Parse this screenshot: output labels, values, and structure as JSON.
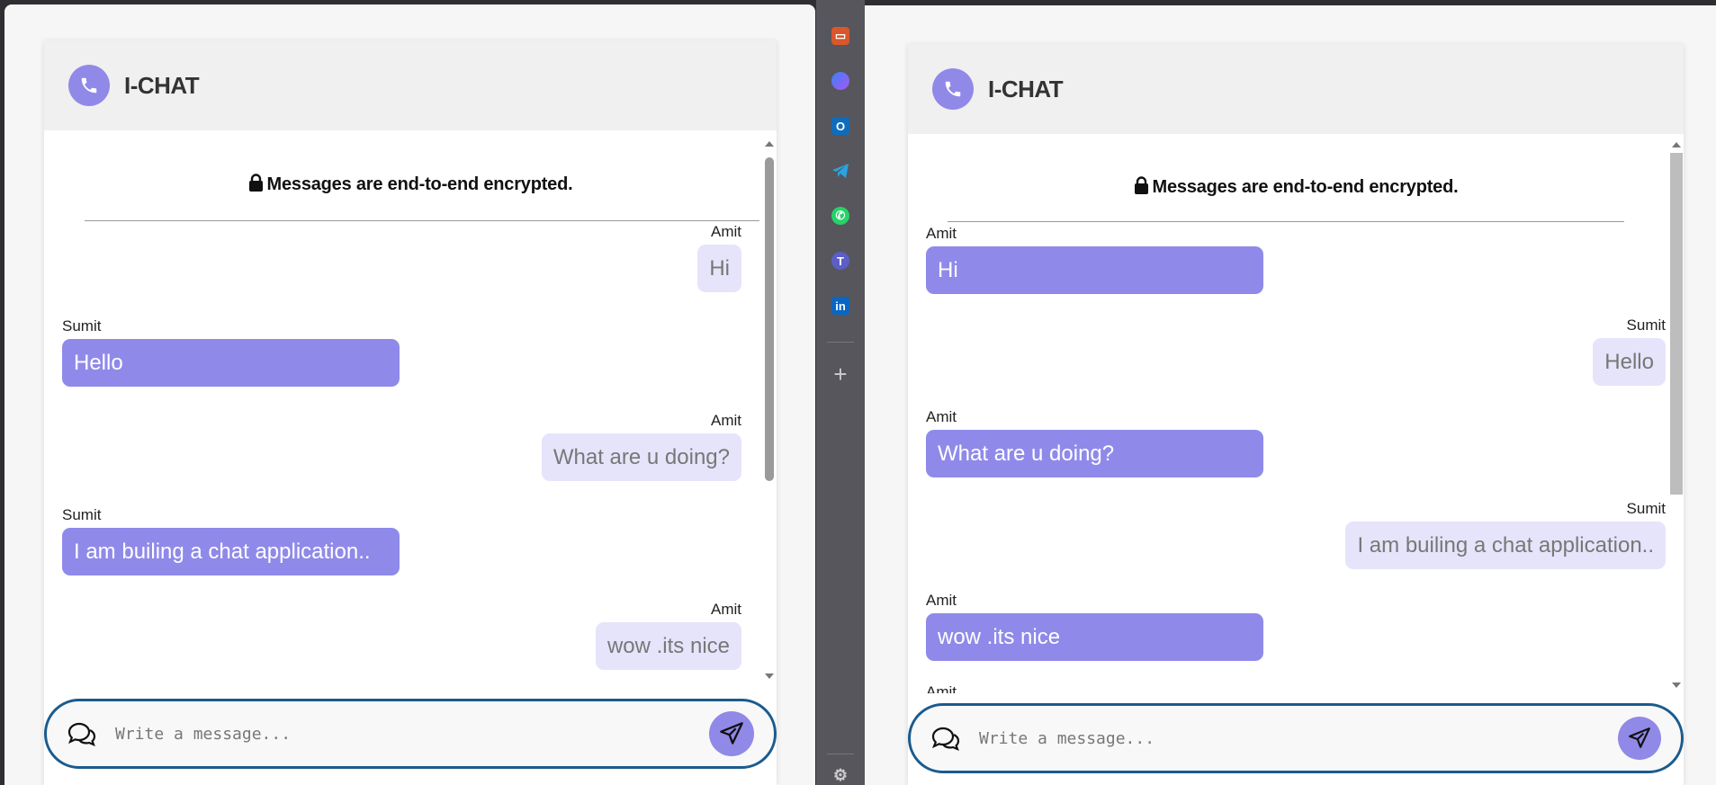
{
  "app": {
    "title": "I-CHAT",
    "encryption_notice": "Messages are end-to-end encrypted.",
    "input_placeholder": "Write a message..."
  },
  "left_chat": {
    "messages": [
      {
        "sender": "Amit",
        "text": "Hi",
        "side": "right"
      },
      {
        "sender": "Sumit",
        "text": "Hello",
        "side": "left"
      },
      {
        "sender": "Amit",
        "text": "What are u doing?",
        "side": "right"
      },
      {
        "sender": "Sumit",
        "text": "I am builing a chat application..",
        "side": "left"
      },
      {
        "sender": "Amit",
        "text": "wow .its nice",
        "side": "right"
      }
    ]
  },
  "right_chat": {
    "messages": [
      {
        "sender": "Amit",
        "text": "Hi",
        "side": "left"
      },
      {
        "sender": "Sumit",
        "text": "Hello",
        "side": "right"
      },
      {
        "sender": "Amit",
        "text": "What are u doing?",
        "side": "left"
      },
      {
        "sender": "Sumit",
        "text": "I am builing a chat application..",
        "side": "right"
      },
      {
        "sender": "Amit",
        "text": "wow .its nice",
        "side": "left"
      },
      {
        "sender": "Amit",
        "text": "",
        "side": "left"
      }
    ]
  },
  "sidebar": {
    "icons": [
      "briefcase-icon",
      "copilot-icon",
      "outlook-icon",
      "telegram-icon",
      "whatsapp-icon",
      "teams-icon",
      "linkedin-icon",
      "add-icon",
      "settings-icon"
    ]
  },
  "colors": {
    "accent": "#9189e8",
    "own_bubble": "#8f8ae9",
    "other_bubble": "#e6e4fa",
    "composer_border": "#1a5b8e",
    "sidebar_bg": "#56565c"
  }
}
